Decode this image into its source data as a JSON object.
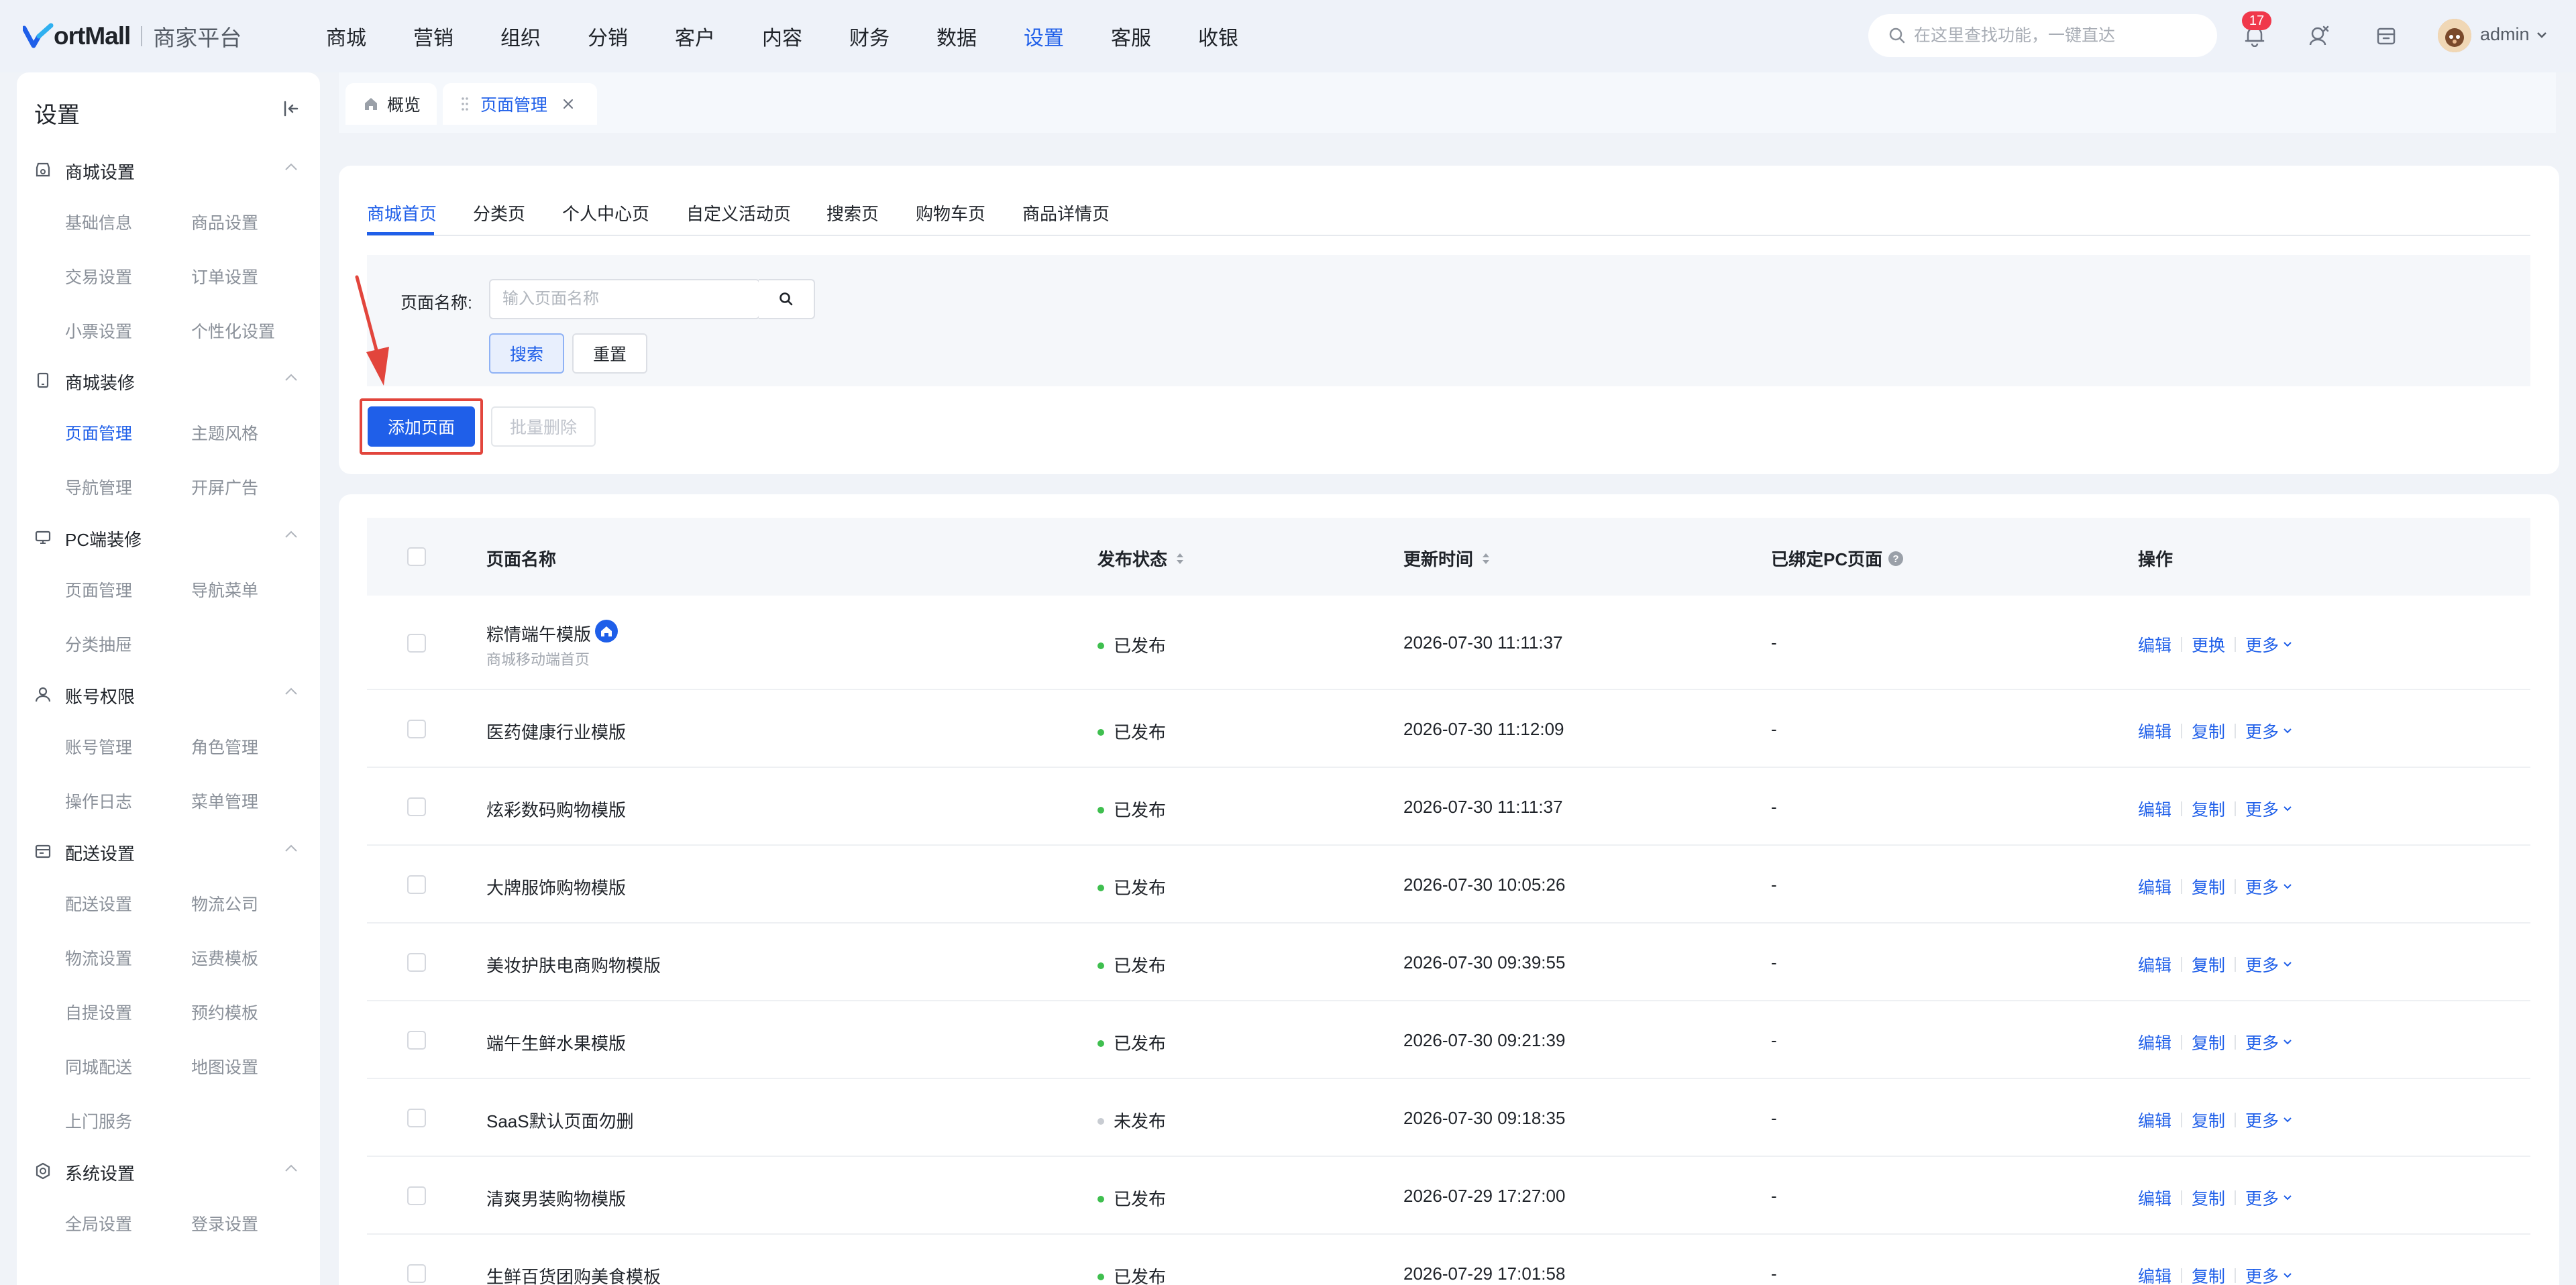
{
  "app": {
    "logo_text": "ortMall",
    "logo_sub": "商家平台",
    "accent": "#1f5fe9"
  },
  "topnav": [
    {
      "label": "商城",
      "active": false
    },
    {
      "label": "营销",
      "active": false
    },
    {
      "label": "组织",
      "active": false
    },
    {
      "label": "分销",
      "active": false
    },
    {
      "label": "客户",
      "active": false
    },
    {
      "label": "内容",
      "active": false
    },
    {
      "label": "财务",
      "active": false
    },
    {
      "label": "数据",
      "active": false
    },
    {
      "label": "设置",
      "active": true
    },
    {
      "label": "客服",
      "active": false
    },
    {
      "label": "收银",
      "active": false
    }
  ],
  "header": {
    "search_placeholder": "在这里查找功能，一键直达",
    "notification_count": "17",
    "user_name": "admin"
  },
  "sidebar": {
    "title": "设置",
    "groups": [
      {
        "label": "商城设置",
        "icon": "shop-settings-icon",
        "items": [
          "基础信息",
          "商品设置",
          "交易设置",
          "订单设置",
          "小票设置",
          "个性化设置"
        ]
      },
      {
        "label": "商城装修",
        "icon": "mobile-decor-icon",
        "items": [
          "页面管理",
          "主题风格",
          "导航管理",
          "开屏广告"
        ]
      },
      {
        "label": "PC端装修",
        "icon": "monitor-icon",
        "items": [
          "页面管理",
          "导航菜单",
          "分类抽屉"
        ]
      },
      {
        "label": "账号权限",
        "icon": "user-permission-icon",
        "items": [
          "账号管理",
          "角色管理",
          "操作日志",
          "菜单管理"
        ]
      },
      {
        "label": "配送设置",
        "icon": "delivery-icon",
        "items": [
          "配送设置",
          "物流公司",
          "物流设置",
          "运费模板",
          "自提设置",
          "预约模板",
          "同城配送",
          "地图设置",
          "上门服务"
        ]
      },
      {
        "label": "系统设置",
        "icon": "system-settings-icon",
        "items": [
          "全局设置",
          "登录设置"
        ]
      }
    ],
    "active_item": "页面管理"
  },
  "page_tabs": [
    {
      "label": "概览",
      "icon": "home-icon"
    },
    {
      "label": "页面管理",
      "closable": true
    }
  ],
  "content_tabs": [
    "商城首页",
    "分类页",
    "个人中心页",
    "自定义活动页",
    "搜索页",
    "购物车页",
    "商品详情页"
  ],
  "active_content_tab": "商城首页",
  "filter": {
    "label": "页面名称:",
    "placeholder": "输入页面名称",
    "search_label": "搜索",
    "reset_label": "重置"
  },
  "actions": {
    "add_label": "添加页面",
    "batch_delete_label": "批量删除"
  },
  "table": {
    "columns": [
      "页面名称",
      "发布状态",
      "更新时间",
      "已绑定PC页面",
      "操作"
    ],
    "rows": [
      {
        "name": "粽情端午模版",
        "sub": "商城移动端首页",
        "home": true,
        "status": "已发布",
        "published": true,
        "time": "2026-07-30 11:11:37",
        "pc": "-",
        "ops": [
          "编辑",
          "更换",
          "更多"
        ]
      },
      {
        "name": "医药健康行业模版",
        "status": "已发布",
        "published": true,
        "time": "2026-07-30 11:12:09",
        "pc": "-",
        "ops": [
          "编辑",
          "复制",
          "更多"
        ]
      },
      {
        "name": "炫彩数码购物模版",
        "status": "已发布",
        "published": true,
        "time": "2026-07-30 11:11:37",
        "pc": "-",
        "ops": [
          "编辑",
          "复制",
          "更多"
        ]
      },
      {
        "name": "大牌服饰购物模版",
        "status": "已发布",
        "published": true,
        "time": "2026-07-30 10:05:26",
        "pc": "-",
        "ops": [
          "编辑",
          "复制",
          "更多"
        ]
      },
      {
        "name": "美妆护肤电商购物模版",
        "status": "已发布",
        "published": true,
        "time": "2026-07-30 09:39:55",
        "pc": "-",
        "ops": [
          "编辑",
          "复制",
          "更多"
        ]
      },
      {
        "name": "端午生鲜水果模版",
        "status": "已发布",
        "published": true,
        "time": "2026-07-30 09:21:39",
        "pc": "-",
        "ops": [
          "编辑",
          "复制",
          "更多"
        ]
      },
      {
        "name": "SaaS默认页面勿删",
        "status": "未发布",
        "published": false,
        "time": "2026-07-30 09:18:35",
        "pc": "-",
        "ops": [
          "编辑",
          "复制",
          "更多"
        ]
      },
      {
        "name": "清爽男装购物模版",
        "status": "已发布",
        "published": true,
        "time": "2026-07-29 17:27:00",
        "pc": "-",
        "ops": [
          "编辑",
          "复制",
          "更多"
        ]
      },
      {
        "name": "生鲜百货团购美食模板",
        "status": "已发布",
        "published": true,
        "time": "2026-07-29 17:01:58",
        "pc": "-",
        "ops": [
          "编辑",
          "复制",
          "更多"
        ]
      }
    ]
  },
  "colors": {
    "published": "#3fbf4f",
    "unpublished": "#c8ccd2",
    "highlight": "#e2453c"
  }
}
